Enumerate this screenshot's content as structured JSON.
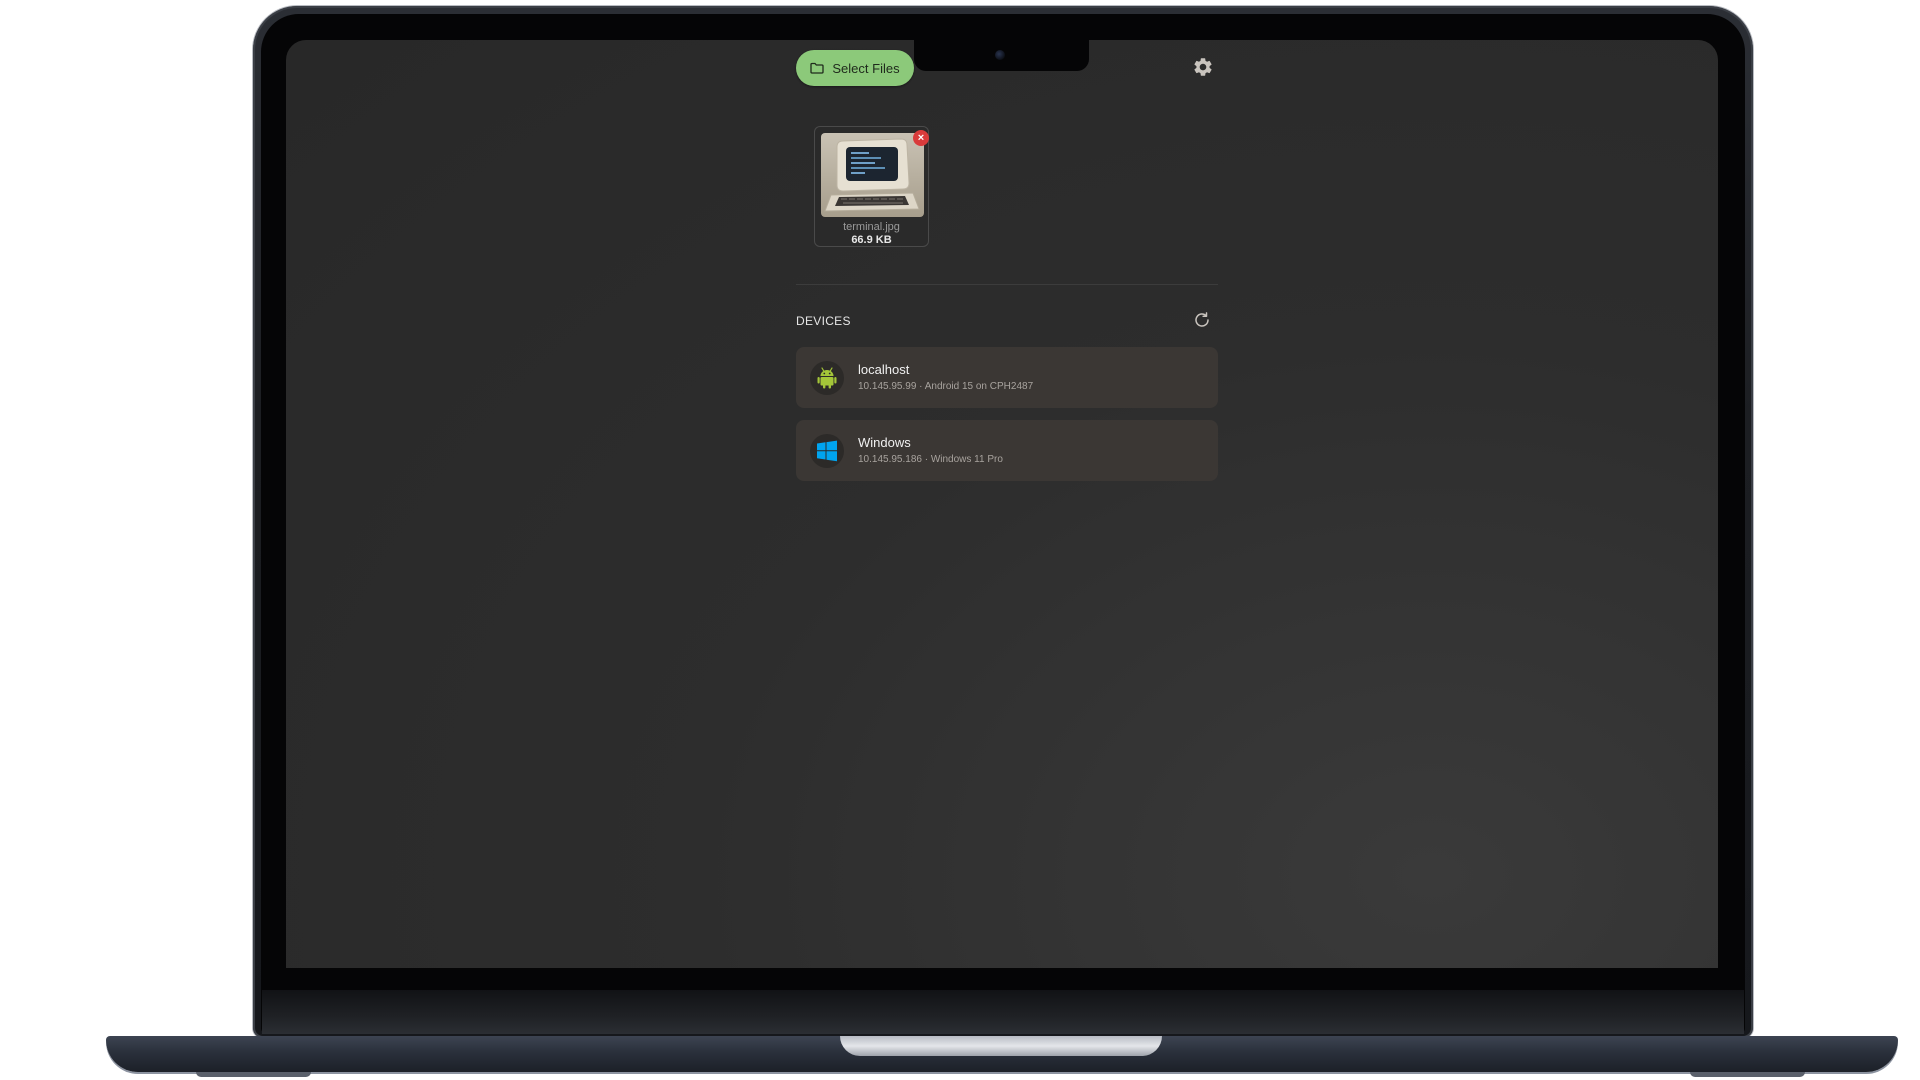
{
  "toolbar": {
    "select_files_label": "Select Files"
  },
  "files": [
    {
      "name": "terminal.jpg",
      "size": "66.9 KB",
      "remove_symbol": "×"
    }
  ],
  "devices": {
    "title": "DEVICES",
    "items": [
      {
        "name": "localhost",
        "detail": "10.145.95.99 · Android 15 on CPH2487",
        "icon": "android-icon"
      },
      {
        "name": "Windows",
        "detail": "10.145.95.186 · Windows 11 Pro",
        "icon": "windows-icon"
      }
    ]
  },
  "icons": {
    "select_files": "folder-icon",
    "settings": "gear-icon",
    "refresh": "refresh-icon",
    "remove": "close-icon"
  },
  "colors": {
    "accent": "#8cc97a",
    "remove": "#d93b3b",
    "android": "#a4c639",
    "windows": "#00a4ef",
    "card": "#3b3734",
    "screen_bg": "#2d2d2d"
  }
}
